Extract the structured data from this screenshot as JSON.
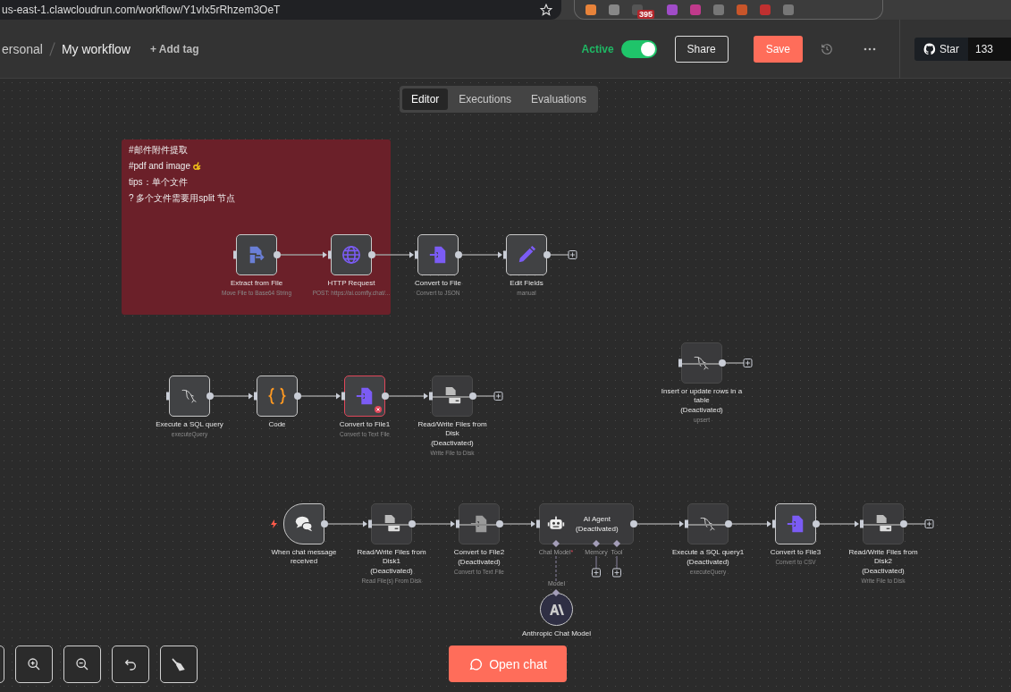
{
  "browser": {
    "url": "us-east-1.clawcloudrun.com/workflow/Y1vIx5rRhzem3OeT",
    "extension_badge": "395"
  },
  "header": {
    "breadcrumb": "ersonal",
    "workflow_name": "My workflow",
    "add_tag": "+ Add tag",
    "active_label": "Active",
    "active": true,
    "share": "Share",
    "save": "Save",
    "star": "Star",
    "star_count": "133"
  },
  "tabs": [
    {
      "label": "Editor",
      "selected": true
    },
    {
      "label": "Executions",
      "selected": false
    },
    {
      "label": "Evaluations",
      "selected": false
    }
  ],
  "sticky_note": {
    "lines": [
      "#邮件附件提取",
      "#pdf and image",
      "tips：单个文件",
      "? 多个文件需要用split 节点"
    ]
  },
  "nodes": [
    {
      "kind": "extract",
      "title": "Extract from File",
      "subtitle": "Move File to Base64 String",
      "deactivated": false,
      "error": false
    },
    {
      "kind": "http",
      "title": "HTTP Request",
      "subtitle": "POST: https://ai.comfly.chat/...",
      "deactivated": false,
      "error": false
    },
    {
      "kind": "convert",
      "title": "Convert to File",
      "subtitle": "Convert to JSON",
      "deactivated": false,
      "error": false
    },
    {
      "kind": "edit",
      "title": "Edit Fields",
      "subtitle": "manual",
      "deactivated": false,
      "error": false
    },
    {
      "kind": "mysql",
      "title": "Execute a SQL query",
      "subtitle": "executeQuery",
      "deactivated": false,
      "error": false
    },
    {
      "kind": "code",
      "title": "Code",
      "deactivated": false,
      "error": false
    },
    {
      "kind": "convert",
      "title": "Convert to File1",
      "subtitle": "Convert to Text File",
      "deactivated": false,
      "error": true
    },
    {
      "kind": "disk",
      "title": "Read/Write Files from Disk",
      "status": "(Deactivated)",
      "subtitle": "Write File to Disk",
      "deactivated": true,
      "error": false
    },
    {
      "kind": "mysql",
      "title": "Insert or update rows in a table",
      "status": "(Deactivated)",
      "subtitle": "upsert",
      "deactivated": true,
      "error": false
    },
    {
      "kind": "chat",
      "title": "When chat message received",
      "deactivated": false,
      "error": false
    },
    {
      "kind": "disk",
      "title": "Read/Write Files from Disk1",
      "status": "(Deactivated)",
      "subtitle": "Read File(s) From Disk",
      "deactivated": true,
      "error": false
    },
    {
      "kind": "convert",
      "title": "Convert to File2",
      "status": "(Deactivated)",
      "subtitle": "Convert to Text File",
      "deactivated": true,
      "error": false
    },
    {
      "kind": "agent",
      "title": "AI Agent",
      "status": "(Deactivated)",
      "deactivated": true,
      "error": false,
      "ports": [
        {
          "label": "Chat Model",
          "mark": "*"
        },
        {
          "label": "Memory"
        },
        {
          "label": "Tool"
        }
      ]
    },
    {
      "kind": "mysql",
      "title": "Execute a SQL query1",
      "status": "(Deactivated)",
      "subtitle": "executeQuery",
      "deactivated": true,
      "error": false
    },
    {
      "kind": "convert",
      "title": "Convert to File3",
      "subtitle": "Convert to CSV",
      "deactivated": false,
      "error": false
    },
    {
      "kind": "disk",
      "title": "Read/Write Files from Disk2",
      "status": "(Deactivated)",
      "subtitle": "Write File to Disk",
      "deactivated": true,
      "error": false
    },
    {
      "kind": "anthropic",
      "title": "Anthropic Chat Model",
      "port_label": "Model",
      "deactivated": false,
      "error": false
    }
  ],
  "open_chat": "Open chat"
}
